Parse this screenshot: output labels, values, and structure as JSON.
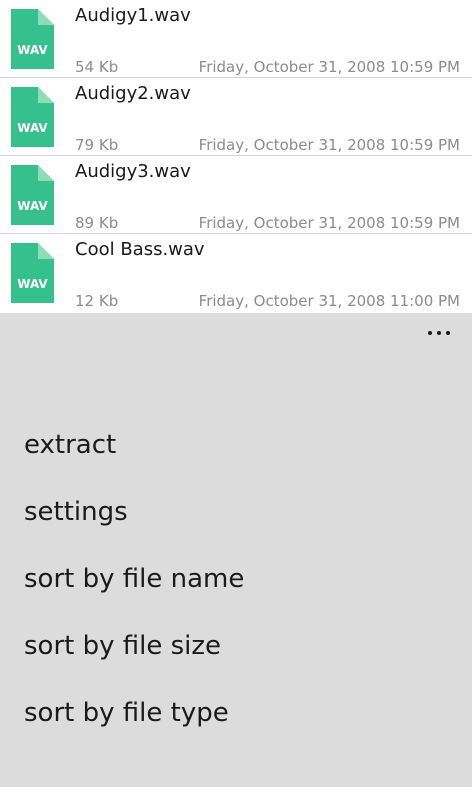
{
  "files": [
    {
      "name": "Audigy1.wav",
      "size": "54 Kb",
      "date": "Friday, October 31, 2008 10:59 PM",
      "icon": "wav-file-icon",
      "icon_label": "WAV"
    },
    {
      "name": "Audigy2.wav",
      "size": "79 Kb",
      "date": "Friday, October 31, 2008 10:59 PM",
      "icon": "wav-file-icon",
      "icon_label": "WAV"
    },
    {
      "name": "Audigy3.wav",
      "size": "89 Kb",
      "date": "Friday, October 31, 2008 10:59 PM",
      "icon": "wav-file-icon",
      "icon_label": "WAV"
    },
    {
      "name": "Cool Bass.wav",
      "size": "12 Kb",
      "date": "Friday, October 31, 2008 11:00 PM",
      "icon": "wav-file-icon",
      "icon_label": "WAV"
    }
  ],
  "app_bar": {
    "more_icon": "more-ellipsis-icon",
    "menu": [
      {
        "label": "extract"
      },
      {
        "label": "settings"
      },
      {
        "label": "sort by file name"
      },
      {
        "label": "sort by file size"
      },
      {
        "label": "sort by file type"
      }
    ]
  },
  "colors": {
    "icon_green": "#36c08e",
    "icon_fold": "#8fdcb9",
    "app_bar_bg": "#dcdcdc",
    "secondary_text": "#8c8c8c"
  }
}
